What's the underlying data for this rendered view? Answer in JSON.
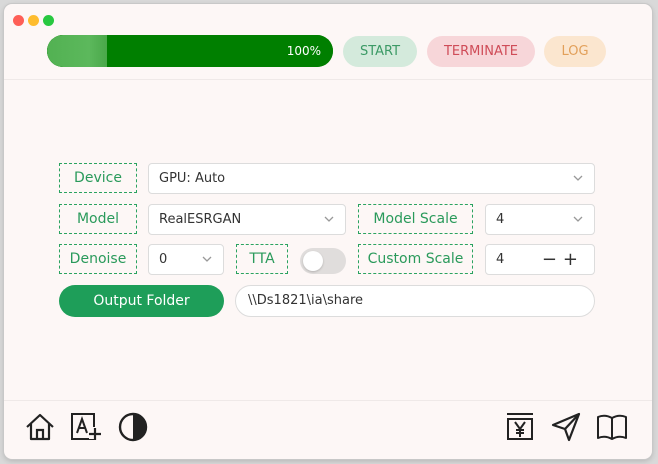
{
  "progress": {
    "percent_label": "100%",
    "value": 1.0
  },
  "actions": {
    "start": "START",
    "terminate": "TERMINATE",
    "log": "LOG"
  },
  "settings": {
    "device": {
      "label": "Device",
      "value": "GPU: Auto"
    },
    "model": {
      "label": "Model",
      "value": "RealESRGAN"
    },
    "model_scale": {
      "label": "Model Scale",
      "value": "4"
    },
    "denoise": {
      "label": "Denoise",
      "value": "0"
    },
    "tta": {
      "label": "TTA",
      "enabled": false
    },
    "custom_scale": {
      "label": "Custom Scale",
      "value": "4",
      "decrement": "−",
      "increment": "+"
    }
  },
  "output": {
    "button": "Output Folder",
    "path": "\\\\Ds1821\\ia\\share"
  },
  "footer_icons": [
    "home-icon",
    "text-add-icon",
    "contrast-icon",
    "yen-bookmark-icon",
    "send-icon",
    "book-icon"
  ],
  "colors": {
    "accent": "#1e9e59",
    "progress": "#007f00",
    "terminate": "#cf4c58",
    "log": "#e2a05a"
  }
}
